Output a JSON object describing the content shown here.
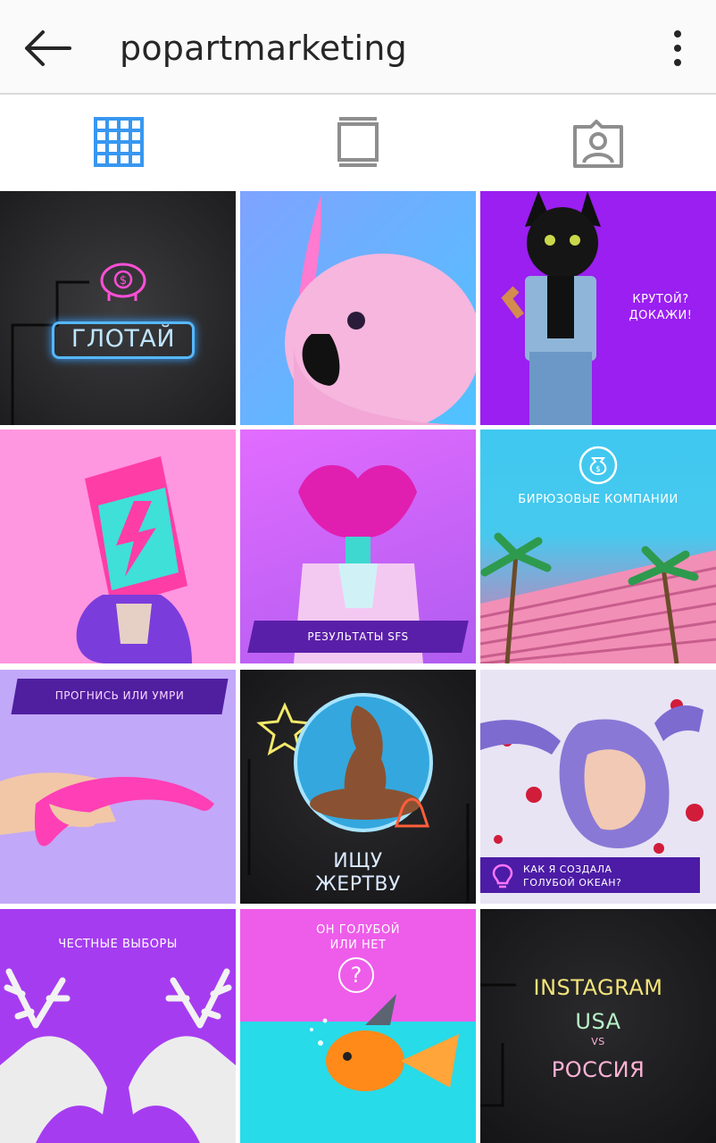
{
  "header": {
    "username": "popartmarketing",
    "back_icon": "arrow-left-icon",
    "more_icon": "more-vertical-icon"
  },
  "tabs": [
    {
      "icon": "grid-icon",
      "active": true
    },
    {
      "icon": "feed-icon",
      "active": false
    },
    {
      "icon": "tagged-icon",
      "active": false
    }
  ],
  "colors": {
    "active_tab": "#3897f0",
    "inactive_tab": "#8e8e8e"
  },
  "posts": [
    {
      "caption": "ГЛОТАЙ"
    },
    {
      "caption": ""
    },
    {
      "caption_line1": "КРУТОЙ?",
      "caption_line2": "ДОКАЖИ!"
    },
    {
      "caption": ""
    },
    {
      "caption": "РЕЗУЛЬТАТЫ SFS"
    },
    {
      "caption": "БИРЮЗОВЫЕ КОМПАНИИ"
    },
    {
      "caption": "ПРОГНИСЬ ИЛИ УМРИ"
    },
    {
      "caption_line1": "ИЩУ",
      "caption_line2": "ЖЕРТВУ"
    },
    {
      "caption_line1": "КАК Я СОЗДАЛА",
      "caption_line2": "ГОЛУБОЙ ОКЕАН?"
    },
    {
      "caption": "ЧЕСТНЫЕ ВЫБОРЫ"
    },
    {
      "caption_line1": "ОН ГОЛУБОЙ",
      "caption_line2": "ИЛИ НЕТ",
      "symbol": "?"
    },
    {
      "caption_line1": "INSTAGRAM",
      "caption_line2": "USA",
      "caption_line3": "VS",
      "caption_line4": "РОССИЯ"
    }
  ]
}
